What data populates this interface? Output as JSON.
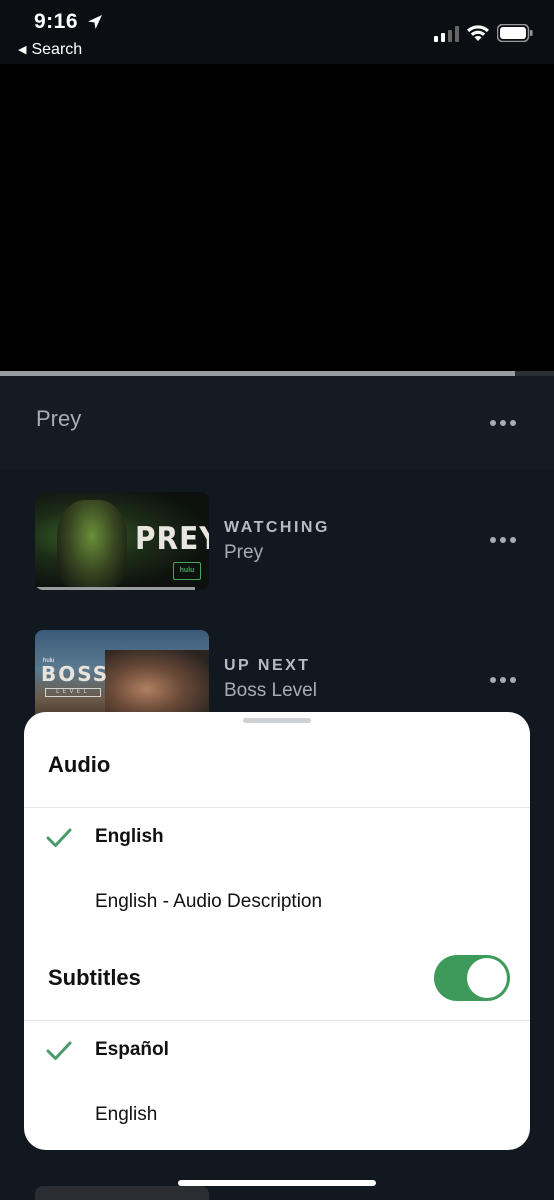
{
  "status_bar": {
    "time": "9:16",
    "back_label": "Search"
  },
  "player": {
    "progress": 0.93,
    "title": "Prey"
  },
  "queue": [
    {
      "label": "WATCHING",
      "title": "Prey",
      "thumb_text": "PREY",
      "thumb_badge": "hulu"
    },
    {
      "label": "UP NEXT",
      "title": "Boss Level",
      "thumb_text": "BOSS",
      "thumb_subtext": "LEVEL",
      "thumb_badge": "hulu"
    }
  ],
  "sheet": {
    "audio_heading": "Audio",
    "audio_options": [
      {
        "label": "English",
        "selected": true
      },
      {
        "label": "English - Audio Description",
        "selected": false
      }
    ],
    "subtitles_heading": "Subtitles",
    "subtitles_enabled": true,
    "subtitle_options": [
      {
        "label": "Español",
        "selected": true
      },
      {
        "label": "English",
        "selected": false
      }
    ]
  },
  "colors": {
    "accent_green": "#3e9a5a",
    "check_green": "#4a9a6a",
    "background": "#111820"
  }
}
